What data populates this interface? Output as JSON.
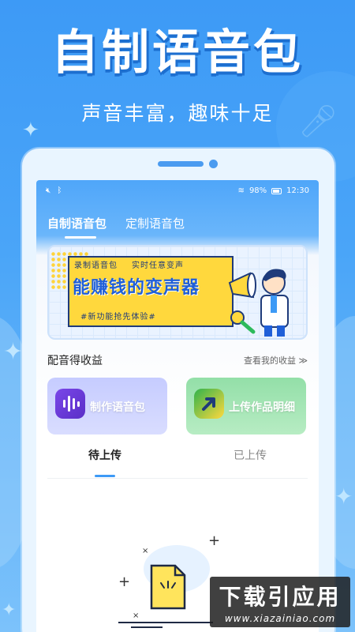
{
  "promo": {
    "headline": "自制语音包",
    "subline": "声音丰富，趣味十足"
  },
  "statusbar": {
    "battery": "98%",
    "time": "12:30"
  },
  "tabs": [
    {
      "label": "自制语音包",
      "active": true
    },
    {
      "label": "定制语音包",
      "active": false
    }
  ],
  "banner": {
    "tag_left": "录制语音包",
    "tag_right": "实时任意变声",
    "title": "能赚钱的变声器",
    "slogan": "#新功能抢先体验#"
  },
  "earnings": {
    "title": "配音得收益",
    "link": "查看我的收益 ≫"
  },
  "cards": {
    "make": "制作语音包",
    "upload": "上传作品明细"
  },
  "subtabs": {
    "pending": "待上传",
    "uploaded": "已上传"
  },
  "watermark": {
    "main": "下载引应用",
    "sub": "www.xiazainiao.com"
  },
  "colors": {
    "background": "#3d9af6",
    "accent": "#3d9af6",
    "banner_yellow": "#ffd83d",
    "make_card": "#c6ccff",
    "upload_card": "#93dfa8"
  },
  "icons": [
    "mute-icon",
    "bluetooth-icon",
    "wifi-icon",
    "battery-icon",
    "microphone-icon",
    "voice-wave-icon",
    "upload-arrow-icon",
    "file-icon",
    "sparkle-icon"
  ]
}
